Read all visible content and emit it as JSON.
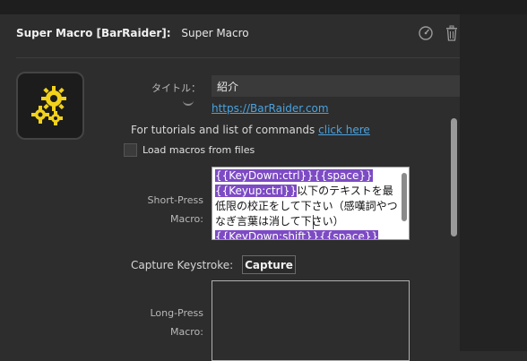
{
  "header": {
    "plugin_name": "Super Macro [BarRaider]:",
    "action_name": "Super Macro",
    "icons": [
      "speedometer-icon",
      "trash-icon"
    ]
  },
  "title_field": {
    "label": "タイトル：",
    "value": "紹介"
  },
  "barraider_link": "https://BarRaider.com",
  "tutorials": {
    "text": "For tutorials and list of commands",
    "link": "click here"
  },
  "load_macros": {
    "label": "Load macros from files",
    "checked": false
  },
  "short_press": {
    "label_line1": "Short-Press",
    "label_line2": "Macro:",
    "seg1": "{{KeyDown:ctrl}}{{space}}",
    "seg2": "{{Keyup:ctrl}}",
    "seg3": "以下のテキストを最低限の校正をして下さい（感嘆詞やつなぎ言葉は消して下さい）",
    "seg4": "{{KeyDown:shift}}{{space}}"
  },
  "capture": {
    "label": "Capture Keystroke:",
    "button": "Capture"
  },
  "long_press": {
    "label_line1": "Long-Press",
    "label_line2": "Macro:"
  },
  "colors": {
    "accent_link": "#4aa3df",
    "selection": "#7d4bc4",
    "gear_yellow": "#f2d21b"
  }
}
